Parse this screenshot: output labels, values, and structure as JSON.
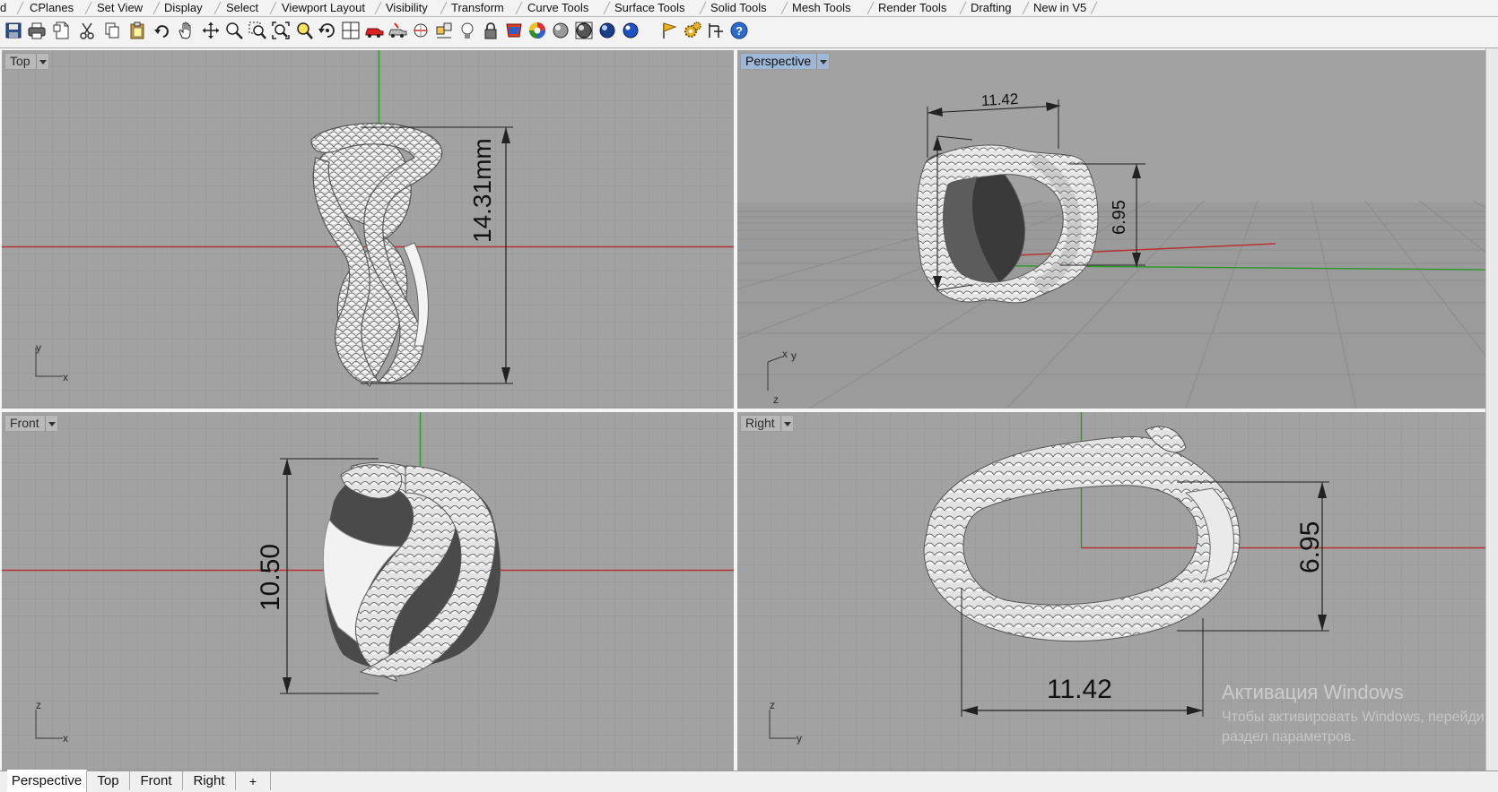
{
  "menu_tabs": [
    "d",
    "CPlanes",
    "Set View",
    "Display",
    "Select",
    "Viewport Layout",
    "Visibility",
    "Transform",
    "Curve Tools",
    "Surface Tools",
    "Solid Tools",
    "Mesh Tools",
    "Render Tools",
    "Drafting",
    "New in V5"
  ],
  "toolbar_icons": [
    "save-icon",
    "print-icon",
    "new-document-icon",
    "cut-icon",
    "copy-icon",
    "paste-icon",
    "undo-icon",
    "pan-hand-icon",
    "move-view-icon",
    "zoom-icon",
    "zoom-window-icon",
    "zoom-extents-icon",
    "zoom-selected-icon",
    "rotate-view-icon",
    "four-viewports-icon",
    "car-named-view-icon",
    "car-camera-icon",
    "ghost-mode-icon",
    "cplane-icon",
    "light-bulb-icon",
    "lock-icon",
    "color-picker-icon",
    "color-wheel-icon",
    "shaded-sphere-icon",
    "rendered-sphere-icon",
    "glossy-sphere-icon",
    "blue-sphere-icon",
    "flag-icon",
    "gear-icon",
    "dimension-icon",
    "help-icon"
  ],
  "viewports": {
    "top": {
      "title": "Top",
      "axis_y": "y",
      "axis_x": "x",
      "dimension": "14.31mm"
    },
    "perspective": {
      "title": "Perspective",
      "axis_x": "x",
      "axis_y": "y",
      "axis_z": "z",
      "dim_width": "11.42",
      "dim_height": "6.95"
    },
    "front": {
      "title": "Front",
      "axis_z": "z",
      "axis_x": "x",
      "dimension": "10.50"
    },
    "right": {
      "title": "Right",
      "axis_z": "z",
      "axis_y": "y",
      "dim_height": "6.95",
      "dim_width": "11.42"
    }
  },
  "watermark": {
    "line1": "Активация Windows",
    "line2": "Чтобы активировать Windows, перейдите в",
    "line3": "раздел параметров."
  },
  "bottom_tabs": [
    "Perspective",
    "Top",
    "Front",
    "Right"
  ],
  "bottom_add": "+",
  "colors": {
    "viewport_bg": "#a2a2a2",
    "grid_line": "#959595",
    "grid_major": "#8a8a8a",
    "x_axis": "#b83232",
    "y_axis": "#2e9a2e",
    "active_title": "#9eb7d6"
  }
}
